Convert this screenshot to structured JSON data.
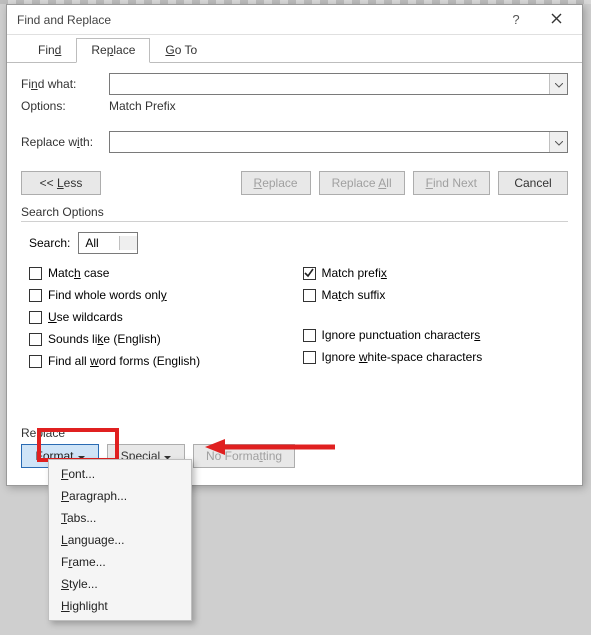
{
  "dialog": {
    "title": "Find and Replace",
    "help": "?",
    "tabs": {
      "find": "Find",
      "replace": "Replace",
      "goto": "Go To"
    },
    "find_what_label": "Find what:",
    "options_label": "Options:",
    "options_value": "Match Prefix",
    "replace_with_label": "Replace with:",
    "buttons": {
      "less": "<<  Less",
      "replace": "Replace",
      "replace_all": "Replace All",
      "find_next": "Find Next",
      "cancel": "Cancel"
    },
    "search_options": {
      "title": "Search Options",
      "search_label": "Search:",
      "search_value": "All",
      "left": {
        "match_case": "Match case",
        "whole_words": "Find whole words only",
        "use_wildcards": "Use wildcards",
        "sounds_like": "Sounds like (English)",
        "word_forms": "Find all word forms (English)"
      },
      "right": {
        "match_prefix": "Match prefix",
        "match_suffix": "Match suffix",
        "ignore_punct": "Ignore punctuation characters",
        "ignore_white": "Ignore white-space characters"
      },
      "checked": {
        "match_prefix": true
      }
    },
    "replace_section": {
      "title": "Replace",
      "format": "Format",
      "special": "Special",
      "no_formatting": "No Formatting"
    }
  },
  "menu": {
    "font": "Font...",
    "paragraph": "Paragraph...",
    "tabs": "Tabs...",
    "language": "Language...",
    "frame": "Frame...",
    "style": "Style...",
    "highlight": "Highlight"
  }
}
